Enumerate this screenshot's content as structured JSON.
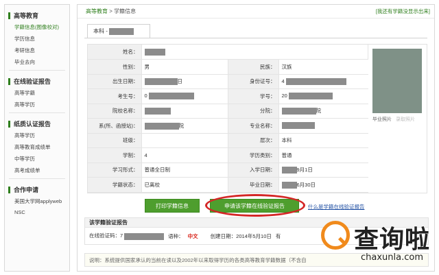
{
  "sidebar": {
    "sections": [
      {
        "title": "高等教育",
        "items": [
          "学籍信息(图像校对)",
          "学历信息",
          "考研信息",
          "毕业去向"
        ]
      },
      {
        "title": "在线验证报告",
        "items": [
          "高等学籍",
          "高等学历"
        ]
      },
      {
        "title": "纸质认证报告",
        "items": [
          "高等学历",
          "高等教育成绩单",
          "中等学历",
          "高考成绩单"
        ]
      },
      {
        "title": "合作申请",
        "items": [
          "美国大学网applyweb",
          "NSC"
        ]
      }
    ]
  },
  "breadcrumb": {
    "home": "高等教育",
    "separator": ">",
    "current": "学籍信息"
  },
  "top_link": "[我还有学籍没显示出来]",
  "tab_label": "本科 -",
  "student": {
    "name_label": "姓名：",
    "rows": [
      {
        "l1": "性别：",
        "v1": "男",
        "l2": "民族：",
        "v2": "汉族"
      },
      {
        "l1": "出生日期：",
        "v1": "日",
        "l2": "身份证号：",
        "v2": "4"
      },
      {
        "l1": "考生号：",
        "v1": "0",
        "l2": "学号：",
        "v2": "20"
      },
      {
        "l1": "院校名称：",
        "v1": "",
        "l2": "分院：",
        "v2": "院"
      },
      {
        "l1": "系(所、函授站)：",
        "v1": "院",
        "l2": "专业名称：",
        "v2": ""
      },
      {
        "l1": "班级：",
        "v1": "",
        "l2": "层次：",
        "v2": "本科"
      },
      {
        "l1": "学制：",
        "v1": "4",
        "l2": "学历类别：",
        "v2": "普通"
      },
      {
        "l1": "学习形式：",
        "v1": "普通全日制",
        "l2": "入学日期：",
        "v2": "9月1日"
      },
      {
        "l1": "学籍状态：",
        "v1": "已离校",
        "l2": "毕业日期：",
        "v2": "6月30日"
      }
    ]
  },
  "photo": {
    "label": "毕业照片",
    "label2": "录取照片"
  },
  "buttons": {
    "print": "打印学籍信息",
    "apply": "申请该学籍在线验证报告"
  },
  "whatis_link": "什么是学籍在线验证报告",
  "verify": {
    "title": "该学籍验证报告",
    "code_label": "在线验证码：7",
    "lang_label": "语种：",
    "lang_value": "中文",
    "created": "创建日期：2014年5月10日",
    "trailing": "有"
  },
  "note": "说明：系统提供国家承认的当前在读以及2002年以来取得学历的各类高等教育学籍数据（不含自",
  "watermark": {
    "text": "查询啦",
    "domain": "chaxunla.com"
  },
  "colors": {
    "accent_green": "#2f7f1d",
    "button_green": "#4e9e2e",
    "highlight_red": "#d42626",
    "watermark_orange": "#f08a1c"
  }
}
